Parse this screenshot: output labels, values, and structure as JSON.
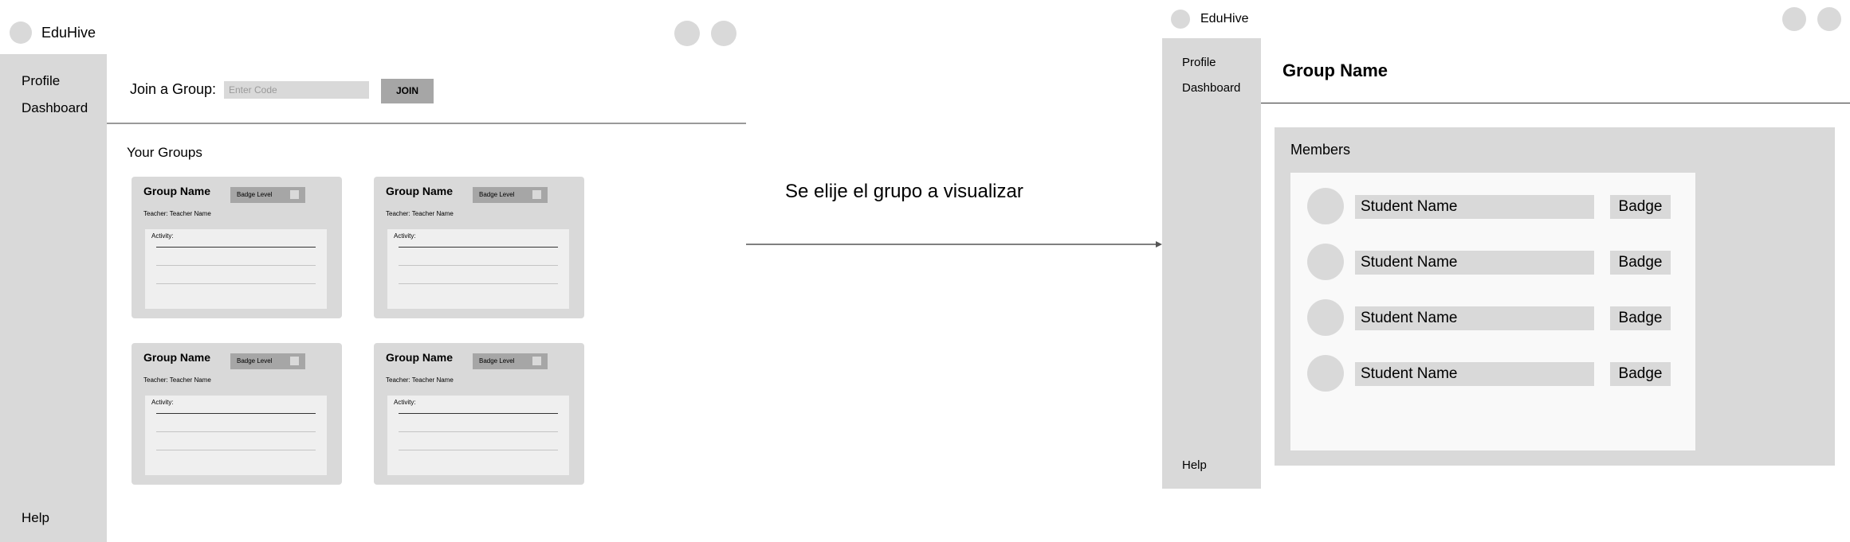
{
  "left": {
    "app_name": "EduHive",
    "sidebar": {
      "profile": "Profile",
      "dashboard": "Dashboard",
      "help": "Help"
    },
    "join": {
      "label": "Join a Group:",
      "placeholder": "Enter Code",
      "button": "JOIN"
    },
    "your_groups_title": "Your Groups",
    "groups": [
      {
        "name": "Group Name",
        "badge": "Badge Level",
        "teacher": "Teacher: Teacher Name",
        "activity": "Activity:"
      },
      {
        "name": "Group Name",
        "badge": "Badge Level",
        "teacher": "Teacher: Teacher Name",
        "activity": "Activity:"
      },
      {
        "name": "Group Name",
        "badge": "Badge Level",
        "teacher": "Teacher: Teacher Name",
        "activity": "Activity:"
      },
      {
        "name": "Group Name",
        "badge": "Badge Level",
        "teacher": "Teacher: Teacher Name",
        "activity": "Activity:"
      }
    ]
  },
  "transition": {
    "caption": "Se elije el grupo a visualizar"
  },
  "right": {
    "app_name": "EduHive",
    "sidebar": {
      "profile": "Profile",
      "dashboard": "Dashboard",
      "help": "Help"
    },
    "group_title": "Group Name",
    "members_title": "Members",
    "members": [
      {
        "name": "Student Name",
        "badge": "Badge"
      },
      {
        "name": "Student Name",
        "badge": "Badge"
      },
      {
        "name": "Student Name",
        "badge": "Badge"
      },
      {
        "name": "Student Name",
        "badge": "Badge"
      }
    ]
  }
}
